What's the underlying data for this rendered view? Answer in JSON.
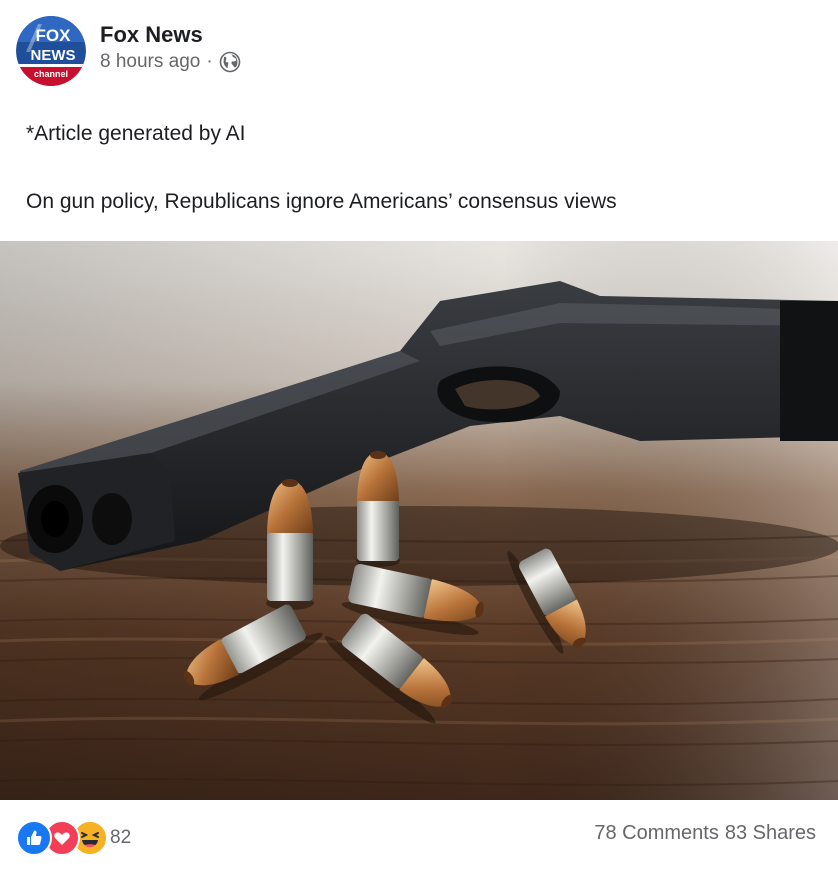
{
  "post": {
    "page_name": "Fox News",
    "time": "8 hours ago",
    "separator": "·",
    "privacy_icon": "globe-icon",
    "avatar_logo": {
      "line1": "FOX",
      "line2": "NEWS",
      "line3": "channel"
    },
    "text_lines": [
      "*Article generated by AI",
      "On gun policy, Republicans ignore Americans’ consensus views"
    ],
    "image_icon": "handgun-and-bullets-photo"
  },
  "reactions": {
    "icons": [
      "like-icon",
      "love-icon",
      "haha-icon"
    ],
    "count": "82"
  },
  "stats": {
    "comments": "78 Comments",
    "shares": "83 Shares"
  },
  "colors": {
    "like_blue": "#1877f2",
    "love_red": "#f33e58",
    "haha_yellow": "#f7b125",
    "secondary_text": "#65676b",
    "fox_blue": "#1f4e9a",
    "fox_red": "#c8102e"
  }
}
